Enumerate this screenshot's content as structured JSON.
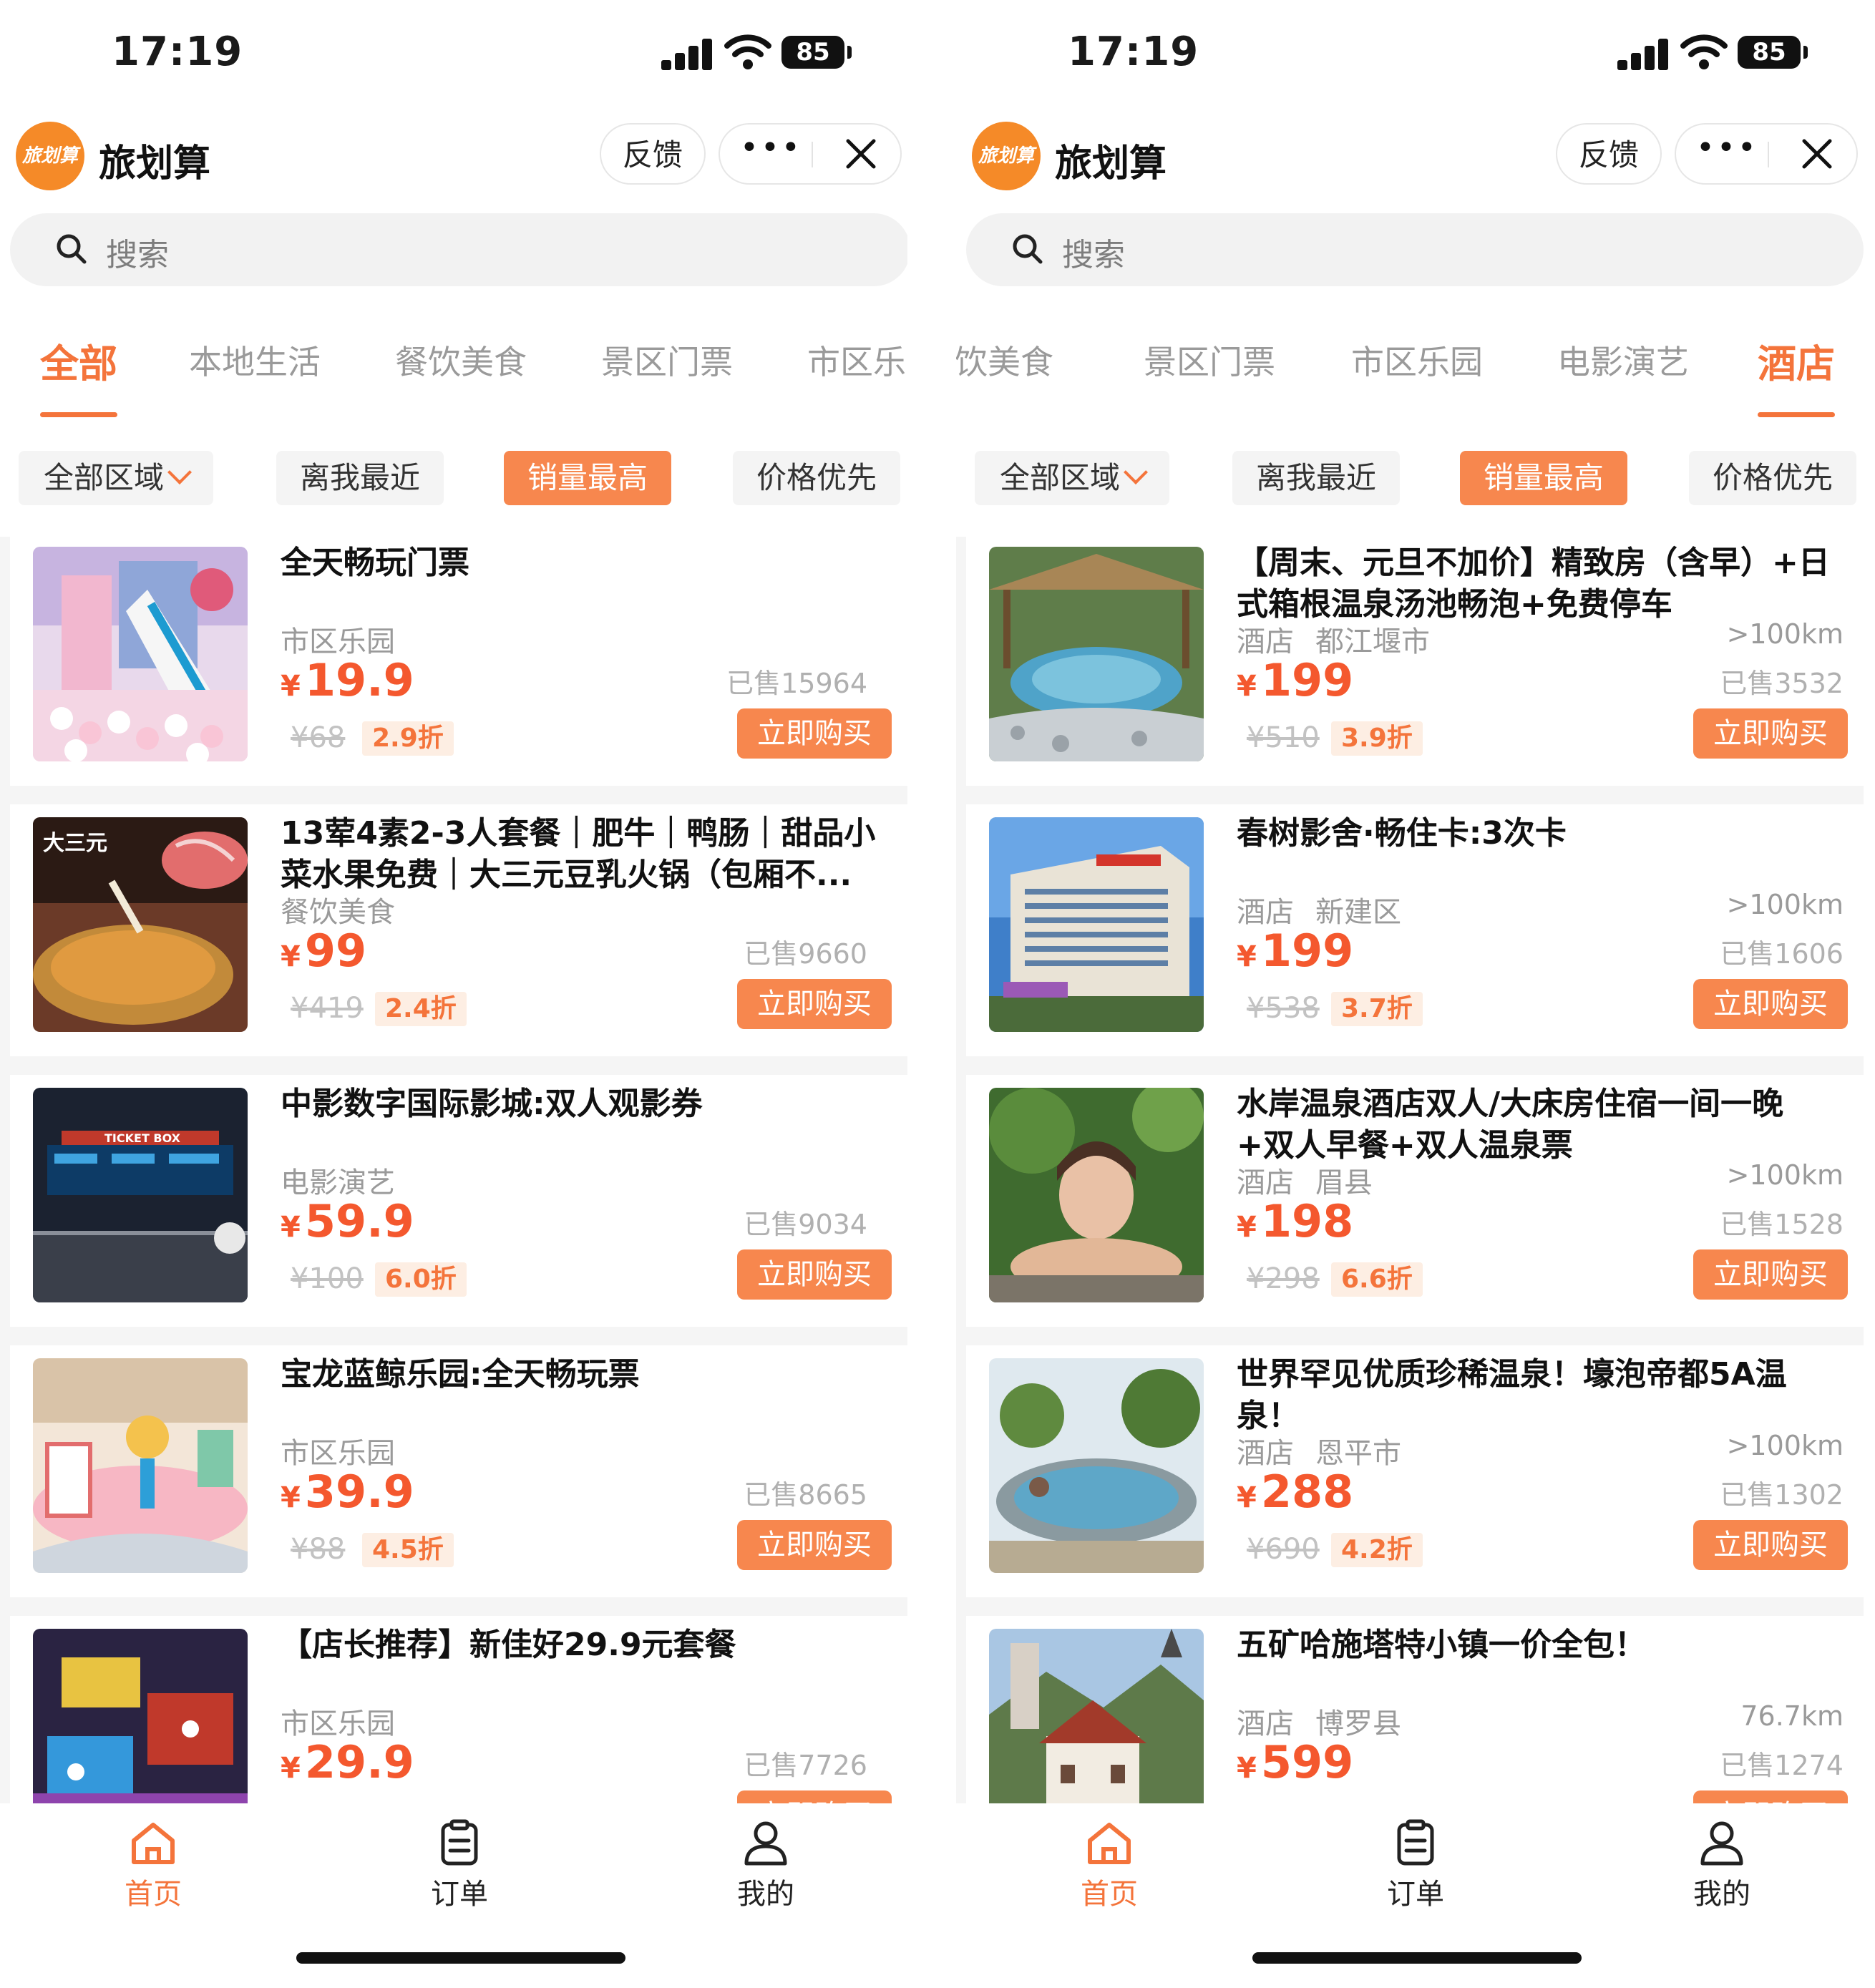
{
  "status": {
    "time": "17:19",
    "battery": "85"
  },
  "app": {
    "title": "旅划算",
    "logo_text": "旅划算",
    "feedback": "反馈",
    "more": "•••"
  },
  "search": {
    "placeholder": "搜索"
  },
  "tabs_left": [
    "全部",
    "本地生活",
    "餐饮美食",
    "景区门票",
    "市区乐园"
  ],
  "tabs_right": [
    "餐饮美食",
    "景区门票",
    "市区乐园",
    "电影演艺",
    "酒店"
  ],
  "filters": {
    "region": "全部区域",
    "nearest": "离我最近",
    "top_sales": "销量最高",
    "price_first": "价格优先"
  },
  "buy_label": "立即购买",
  "left_list": [
    {
      "title": "全天畅玩门票",
      "category": "市区乐园",
      "price": "19.9",
      "sold": "已售15964",
      "original": "¥68",
      "discount": "2.9折"
    },
    {
      "title": "13荤4素2-3人套餐｜肥牛｜鸭肠｜甜品小菜水果免费｜大三元豆乳火锅（包厢不...",
      "category": "餐饮美食",
      "price": "99",
      "sold": "已售9660",
      "original": "¥419",
      "discount": "2.4折"
    },
    {
      "title": "中影数字国际影城:双人观影券",
      "category": "电影演艺",
      "price": "59.9",
      "sold": "已售9034",
      "original": "¥100",
      "discount": "6.0折"
    },
    {
      "title": "宝龙蓝鲸乐园:全天畅玩票",
      "category": "市区乐园",
      "price": "39.9",
      "sold": "已售8665",
      "original": "¥88",
      "discount": "4.5折"
    },
    {
      "title": "【店长推荐】新佳好29.9元套餐",
      "category": "市区乐园",
      "price": "29.9",
      "sold": "已售7726",
      "original": "",
      "discount": ""
    }
  ],
  "right_list": [
    {
      "title": "【周末、元旦不加价】精致房（含早）+日式箱根温泉汤池畅泡+免费停车",
      "category": "酒店",
      "location": "都江堰市",
      "distance": ">100km",
      "price": "199",
      "sold": "已售3532",
      "original": "¥510",
      "discount": "3.9折"
    },
    {
      "title": "春树影舍·畅住卡:3次卡",
      "category": "酒店",
      "location": "新建区",
      "distance": ">100km",
      "price": "199",
      "sold": "已售1606",
      "original": "¥538",
      "discount": "3.7折"
    },
    {
      "title": "水岸温泉酒店双人/大床房住宿一间一晚+双人早餐+双人温泉票",
      "category": "酒店",
      "location": "眉县",
      "distance": ">100km",
      "price": "198",
      "sold": "已售1528",
      "original": "¥298",
      "discount": "6.6折"
    },
    {
      "title": "世界罕见优质珍稀温泉！壕泡帝都5A温泉！",
      "category": "酒店",
      "location": "恩平市",
      "distance": ">100km",
      "price": "288",
      "sold": "已售1302",
      "original": "¥690",
      "discount": "4.2折"
    },
    {
      "title": "五矿哈施塔特小镇一价全包！",
      "category": "酒店",
      "location": "博罗县",
      "distance": "76.7km",
      "price": "599",
      "sold": "已售1274",
      "original": "",
      "discount": ""
    }
  ],
  "tabbar": {
    "home": "首页",
    "orders": "订单",
    "mine": "我的"
  },
  "currency": "¥",
  "colors": {
    "accent": "#f4743b",
    "price": "#f4582e",
    "button": "#f7874e",
    "logo": "#f58a28"
  }
}
